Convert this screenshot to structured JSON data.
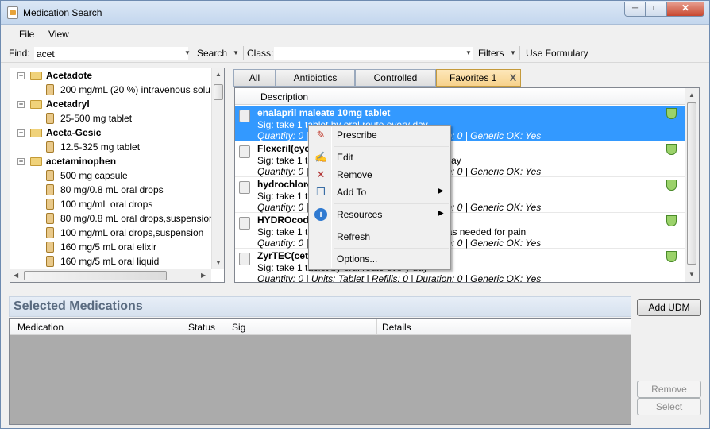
{
  "window": {
    "title": "Medication Search"
  },
  "menu": [
    "File",
    "View"
  ],
  "toolbar": {
    "find_label": "Find:",
    "find_value": "acet",
    "search_label": "Search",
    "class_label": "Class:",
    "class_value": "",
    "filters_label": "Filters",
    "formulary_label": "Use Formulary"
  },
  "tree": [
    {
      "text": "Acetadote",
      "group": true
    },
    {
      "text": "200 mg/mL (20 %) intravenous solu",
      "group": false
    },
    {
      "text": "Acetadryl",
      "group": true
    },
    {
      "text": "25-500 mg tablet",
      "group": false
    },
    {
      "text": "Aceta-Gesic",
      "group": true
    },
    {
      "text": "12.5-325 mg tablet",
      "group": false
    },
    {
      "text": "acetaminophen",
      "group": true
    },
    {
      "text": "500 mg capsule",
      "group": false
    },
    {
      "text": "80 mg/0.8 mL oral drops",
      "group": false
    },
    {
      "text": "100 mg/mL oral drops",
      "group": false
    },
    {
      "text": "80 mg/0.8 mL oral drops,suspension",
      "group": false
    },
    {
      "text": "100 mg/mL oral drops,suspension",
      "group": false
    },
    {
      "text": "160 mg/5 mL oral elixir",
      "group": false
    },
    {
      "text": "160 mg/5 mL oral liquid",
      "group": false
    }
  ],
  "tabs": [
    "All",
    "Antibiotics",
    "Controlled",
    "Favorites 1"
  ],
  "tab_close": "X",
  "grid": {
    "header": "Description",
    "rows": [
      {
        "name": "enalapril maleate 10mg tablet",
        "sig": "Sig: take 1 tablet by oral route  every day",
        "qty": "Quantity: 0 | Units: Tablet | Refills: 0 | Duration: 0 | Generic OK: Yes",
        "selected": true
      },
      {
        "name": "Flexeril(cyclobenzaprine)",
        "sig": "Sig: take 1 tablet by oral route 3 times every day",
        "qty": "Quantity: 0 | Units: Tablet | Refills: 0 | Duration: 0 | Generic OK: Yes",
        "selected": false
      },
      {
        "name": "hydrochlorothiazide",
        "sig": "Sig: take 1 tablet by oral route every day",
        "qty": "Quantity: 0 | Units: Tablet | Refills: 0 | Duration: 0 | Generic OK: Yes",
        "selected": false
      },
      {
        "name": "HYDROcodone-acetaminophen tablet",
        "sig": "Sig: take 1 tablet by oral route every 6 hours as needed for pain",
        "qty": "Quantity: 0 | Units: Tablet | Refills: 0 | Duration: 0 | Generic OK: Yes",
        "selected": false
      },
      {
        "name": "ZyrTEC(cetirizine)",
        "sig": "Sig: take 1 tablet by oral route every day",
        "qty": "Quantity: 0 | Units: Tablet | Refills: 0 | Duration: 0 | Generic OK: Yes",
        "selected": false
      }
    ]
  },
  "selected": {
    "title": "Selected Medications",
    "columns": [
      "Medication",
      "Status",
      "Sig",
      "Details"
    ]
  },
  "buttons": {
    "add_udm": "Add UDM",
    "remove": "Remove",
    "select": "Select"
  },
  "context_menu": [
    {
      "label": "Prescribe",
      "icon": "prescribe-icon"
    },
    {
      "label": "Edit",
      "icon": "edit-icon"
    },
    {
      "label": "Remove",
      "icon": "remove-icon"
    },
    {
      "label": "Add To",
      "icon": "add-to-icon",
      "submenu": true
    },
    {
      "label": "Resources",
      "icon": "info-icon",
      "submenu": true
    },
    {
      "label": "Refresh",
      "icon": ""
    },
    {
      "label": "Options...",
      "icon": ""
    }
  ]
}
